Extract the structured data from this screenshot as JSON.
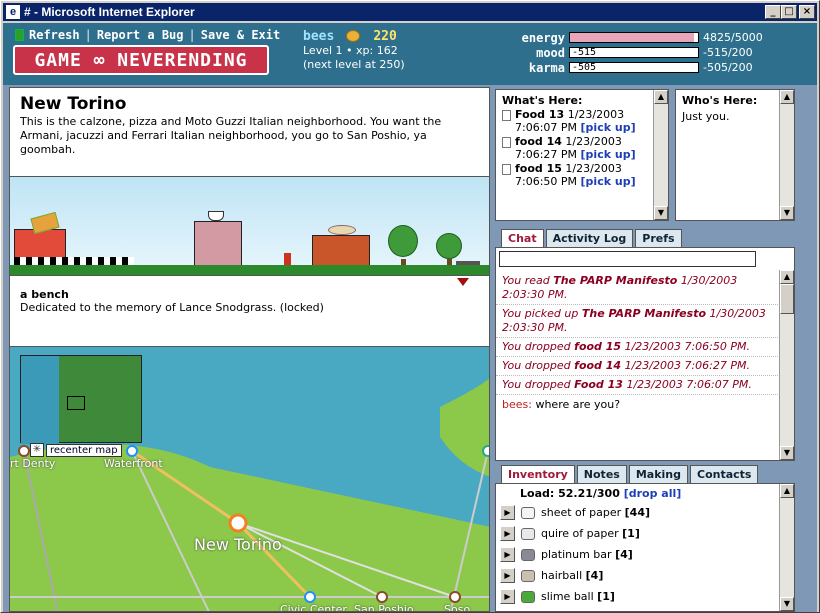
{
  "window": {
    "title": "# - Microsoft Internet Explorer",
    "btn_min": "_",
    "btn_max": "□",
    "btn_close": "×"
  },
  "header": {
    "links": [
      "Refresh",
      "Report a Bug",
      "Save & Exit"
    ],
    "separator": "|",
    "logo": "GAME ∞ NEVERENDING",
    "player_name": "bees",
    "coins": "220",
    "level_line": "Level 1 • xp: 162",
    "next_level": "(next level at 250)",
    "stats": [
      {
        "label": "energy",
        "value": "4825/5000",
        "fill": 0.965,
        "neg": ""
      },
      {
        "label": "mood",
        "value": "-515/200",
        "fill": 0,
        "neg": "-515"
      },
      {
        "label": "karma",
        "value": "-505/200",
        "fill": 0,
        "neg": "-505"
      }
    ]
  },
  "location": {
    "title": "New Torino",
    "description": "This is the calzone, pizza and Moto Guzzi Italian neighborhood. You want the Armani, jacuzzi and Ferrari Italian neighborhood, you go to San Poshio, ya goombah.",
    "item_title": "a bench",
    "item_desc": "Dedicated to the memory of Lance Snodgrass. (locked)"
  },
  "map": {
    "recenter": "recenter map",
    "labels": {
      "port_denty": "rt Denty",
      "waterfront": "Waterfront",
      "new_torino": "New Torino",
      "civic_center": "Civic Center",
      "san_poshio": "San Poshio",
      "soso": "Soso"
    }
  },
  "whats_here": {
    "title": "What's Here:",
    "items": [
      {
        "name": "Food 13",
        "date": "1/23/2003",
        "time": "7:06:07 PM",
        "action": "[pick up]"
      },
      {
        "name": "food 14",
        "date": "1/23/2003",
        "time": "7:06:27 PM",
        "action": "[pick up]"
      },
      {
        "name": "food 15",
        "date": "1/23/2003",
        "time": "7:06:50 PM",
        "action": "[pick up]"
      }
    ]
  },
  "whos_here": {
    "title": "Who's Here:",
    "text": "Just you."
  },
  "chat": {
    "tabs": [
      "Chat",
      "Activity Log",
      "Prefs"
    ],
    "messages": [
      {
        "pre": "You read ",
        "bold": "The PARP Manifesto",
        "post": " 1/30/2003 2:03:30 PM."
      },
      {
        "pre": "You picked up ",
        "bold": "The PARP Manifesto",
        "post": " 1/30/2003 2:03:30 PM."
      },
      {
        "pre": "You dropped ",
        "bold": "food 15",
        "post": " 1/23/2003 7:06:50 PM."
      },
      {
        "pre": "You dropped ",
        "bold": "food 14",
        "post": " 1/23/2003 7:06:27 PM."
      },
      {
        "pre": "You dropped ",
        "bold": "Food 13",
        "post": " 1/23/2003 7:06:07 PM."
      }
    ],
    "last_name": "bees:",
    "last_text": " where are you?"
  },
  "inventory": {
    "tabs": [
      "Inventory",
      "Notes",
      "Making",
      "Contacts"
    ],
    "load_label": "Load: 52.21/300",
    "drop_all": "[drop all]",
    "items": [
      {
        "name": "sheet of paper",
        "count": "[44]",
        "icon": "paper-icon",
        "color": "#f4f4f4"
      },
      {
        "name": "quire of paper",
        "count": "[1]",
        "icon": "quire-icon",
        "color": "#e8e8e8"
      },
      {
        "name": "platinum bar",
        "count": "[4]",
        "icon": "bar-icon",
        "color": "#8a8a96"
      },
      {
        "name": "hairball",
        "count": "[4]",
        "icon": "hairball-icon",
        "color": "#c9c0b0"
      },
      {
        "name": "slime ball",
        "count": "[1]",
        "icon": "slime-icon",
        "color": "#4caa3a"
      }
    ]
  }
}
